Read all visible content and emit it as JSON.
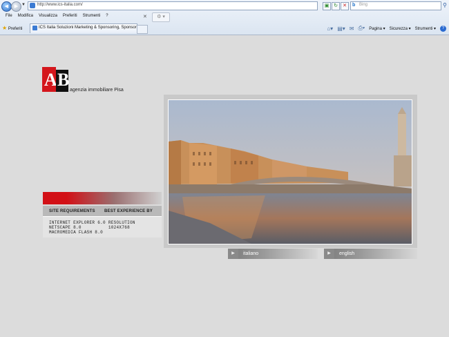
{
  "browser": {
    "url": "http://www.ics-italia.com/",
    "search_placeholder": "Bing",
    "menu": [
      "File",
      "Modifica",
      "Visualizza",
      "Preferiti",
      "Strumenti",
      "?"
    ],
    "favorites_label": "Preferiti",
    "tab_title": "ICS Italia Soluzioni Marketing & Sponsoring, Sponsors...",
    "commands": {
      "page": "Pagina ▾",
      "security": "Sicurezza ▾",
      "tools": "Strumenti ▾"
    }
  },
  "site": {
    "tagline": "agenzia immobiliare Pisa",
    "requirements": {
      "head_left": "SITE REQUIREMENTS",
      "head_right": "BEST EXPERIENCE BY",
      "line1": "INTERNET EXPLORER 6.0 RESOLUTION",
      "line2": "NETSCAPE 8.0          1024X768",
      "line3": "MACROMEDIA FLASH 8.0"
    },
    "lang_italian": "italiano",
    "lang_english": "english"
  },
  "colors": {
    "brand_red": "#d4161c",
    "page_bg": "#dcdcdc"
  }
}
